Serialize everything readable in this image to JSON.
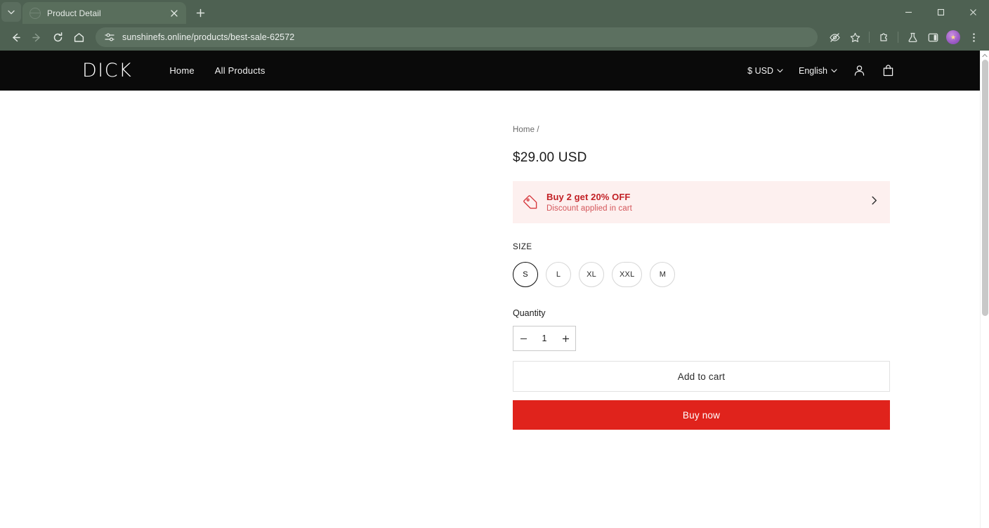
{
  "browser": {
    "tab": {
      "title": "Product Detail",
      "favicon_name": "globe-favicon",
      "close_label": "×"
    },
    "tab_list_button": "tab-search",
    "new_tab_button": "+",
    "window_controls": {
      "minimize": "—",
      "maximize": "▢",
      "close": "×"
    },
    "toolbar": {
      "back": "back-arrow",
      "forward": "forward-arrow",
      "reload": "reload",
      "home": "home",
      "url": "sunshinefs.online/products/best-sale-62572",
      "url_placeholder": "Search Google or type a URL",
      "site_settings_icon": "tune-icon",
      "tracking_protection": "eye-slash-icon",
      "bookmark": "star-icon",
      "extensions": "puzzle-icon",
      "labs": "flask-icon",
      "side_panel": "sidepanel-icon",
      "profile": "avatar",
      "menu": "three-dot-menu"
    }
  },
  "site": {
    "brand": "DICK",
    "nav": [
      {
        "label": "Home"
      },
      {
        "label": "All Products"
      }
    ],
    "currency": "$ USD",
    "language": "English",
    "account_icon": "person-icon",
    "cart_icon": "shopping-bag-icon"
  },
  "product": {
    "breadcrumb": "Home /",
    "breadcrumb_home": "Home",
    "price": "$29.00 USD",
    "promo": {
      "icon": "price-tag-icon",
      "title": "Buy 2 get 20% OFF",
      "subtitle": "Discount applied in cart",
      "chevron": "chevron-right-icon"
    },
    "size": {
      "label": "SIZE",
      "options": [
        {
          "label": "S",
          "selected": true
        },
        {
          "label": "L",
          "selected": false
        },
        {
          "label": "XL",
          "selected": false
        },
        {
          "label": "XXL",
          "selected": false
        },
        {
          "label": "M",
          "selected": false
        }
      ]
    },
    "quantity": {
      "label": "Quantity",
      "value": "1",
      "decrease": "−",
      "increase": "+"
    },
    "actions": {
      "add_to_cart": "Add to cart",
      "buy_now": "Buy now"
    }
  },
  "colors": {
    "chrome": "#4e6152",
    "header_bg": "#0a0a0a",
    "promo_bg": "#fdf0ef",
    "promo_text": "#c21f24",
    "buy_now": "#e0231c"
  }
}
